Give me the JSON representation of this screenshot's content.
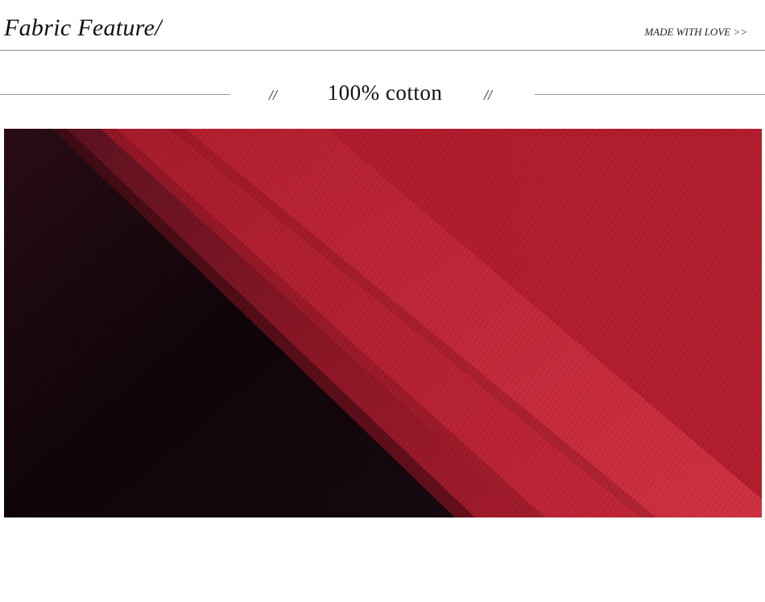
{
  "header": {
    "title": "Fabric Feature/",
    "link_text": "MADE WITH LOVE >>"
  },
  "section": {
    "slash_left": "//",
    "title": "100% cotton",
    "slash_right": "//"
  },
  "photo": {
    "subject": "folded fabric",
    "colors": {
      "dark": "#1a0a10",
      "burgundy": "#5a0f1c",
      "red": "#b01c2e",
      "highlight": "#d4303f"
    }
  }
}
